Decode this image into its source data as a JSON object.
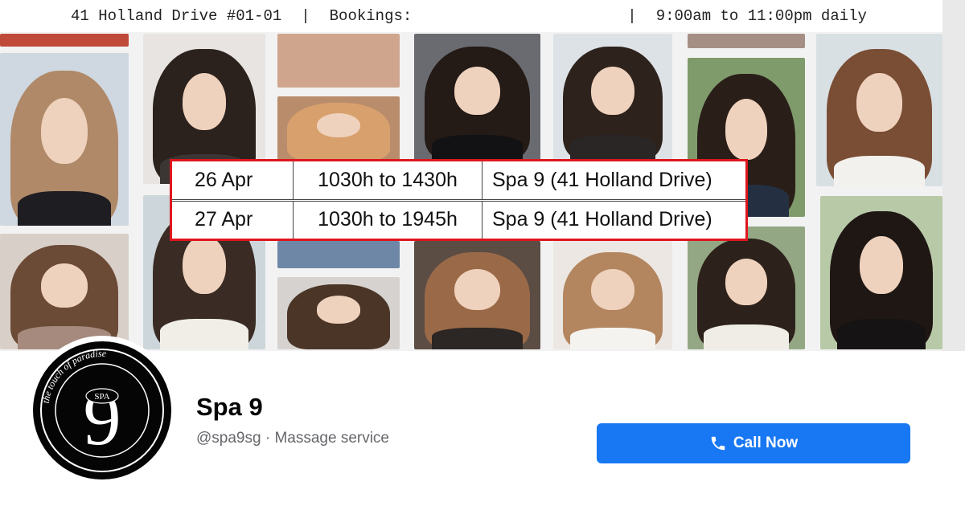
{
  "cover": {
    "info_strip": {
      "address": "41 Holland Drive #01-01",
      "separator": "|",
      "bookings_label": "Bookings:",
      "hours": "9:00am to 11:00pm daily"
    },
    "schedule": [
      {
        "date": "26 Apr",
        "time": "1030h to 1430h",
        "location": "Spa 9 (41 Holland Drive)"
      },
      {
        "date": "27 Apr",
        "time": "1030h to 1945h",
        "location": "Spa 9 (41 Holland Drive)"
      }
    ],
    "highlight_color": "#e0161d"
  },
  "profile": {
    "avatar": {
      "logo_text": "9",
      "badge": "SPA",
      "ring_text": "the touch of paradise"
    },
    "name": "Spa 9",
    "subtitle": "@spa9sg · Massage service"
  },
  "actions": {
    "call_label": "Call Now",
    "call_icon": "phone-icon",
    "accent": "#1877f2"
  }
}
